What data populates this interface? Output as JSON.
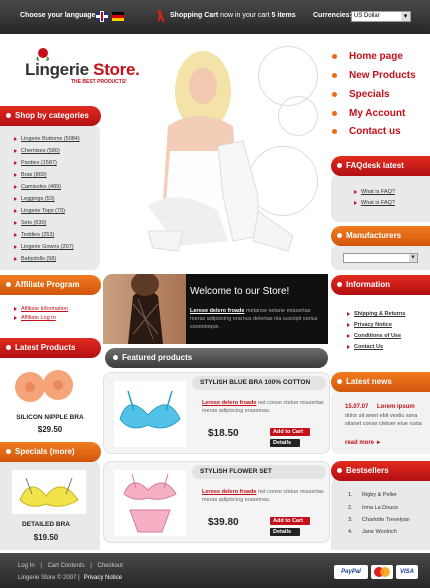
{
  "topbar": {
    "language_label": "Choose your language:",
    "cart_label": "Shopping Cart",
    "cart_status": "now in your cart",
    "cart_count": "5 items",
    "currency_label": "Currencies:",
    "currency_value": "US Dollar"
  },
  "logo": {
    "title_part1": "Lingerie ",
    "title_part2": "Store.",
    "slogan": "THE BEST PRODUCTS!"
  },
  "nav": {
    "items": [
      "Home page",
      "New Products",
      "Specials",
      "My Account",
      "Contact us"
    ]
  },
  "categories": {
    "heading": "Shop by categories",
    "items": [
      "Lingerie Bottoms (5084)",
      "Chemises (580)",
      "Panties (1587)",
      "Bras (869)",
      "Camisoles (489)",
      "Leggings (53)",
      "Lingerie Tops (79)",
      "Sets (630)",
      "Teddies (253)",
      "Lingerie Gowns (207)",
      "Babydolls (58)"
    ]
  },
  "affiliate": {
    "heading": "Affiliate Program",
    "links": [
      "Affiliate Information",
      "Affiliate Log In"
    ]
  },
  "latest": {
    "heading": "Latest Products",
    "product_name": "SILICON NIPPLE BRA",
    "product_price": "$29.50"
  },
  "specials": {
    "heading": "Specials",
    "more": "(more)",
    "product_name": "DETAILED BRA",
    "product_price": "$19.50"
  },
  "welcome": {
    "title": "Welcome to our Store!",
    "lead": "Lerose delero froade",
    "text": "metanse setane miasertas meras adipiscing erarnus delertas nia suscipit varius sooestoque."
  },
  "featured": {
    "heading": "Featured products",
    "products": [
      {
        "name": "STYLISH BLUE BRA 100% COTTON",
        "lead": "Lerose delero froade",
        "desc": "net conse ctetue miasertas meras adipiscing erasemas.",
        "price": "$18.50",
        "add_label": "Add to Cart",
        "details_label": "Details"
      },
      {
        "name": "STYLISH FLOWER SET",
        "lead": "Lerose delero froade",
        "desc": "net conse ctetue miasertas meras adipiscing erasemas.",
        "price": "$39.80",
        "add_label": "Add to Cart",
        "details_label": "Details"
      }
    ]
  },
  "faq": {
    "heading": "FAQdesk latest",
    "items": [
      "What is FAQ?",
      "What is FAQ?"
    ]
  },
  "manufacturers": {
    "heading": "Manufacturers"
  },
  "information": {
    "heading": "Information",
    "items": [
      "Shipping & Returns",
      "Privacy Notice",
      "Conditions of Use",
      "Contact Us"
    ]
  },
  "news": {
    "heading": "Latest news",
    "date": "15.07.07",
    "title": "Lorem ipsum",
    "body": "dolor sit amet ebit vestiu ssna sitanet conse ctetuer etue rusta",
    "read_more": "read more"
  },
  "bestsellers": {
    "heading": "Bestsellers",
    "items": [
      {
        "num": "1.",
        "name": "Rigby & Peller"
      },
      {
        "num": "2.",
        "name": "Irma La Douce"
      },
      {
        "num": "3.",
        "name": "Charlotte Trevelyan"
      },
      {
        "num": "4.",
        "name": "Jane Woolrich"
      }
    ]
  },
  "footer": {
    "links": [
      "Log In",
      "|",
      "Cart Contents",
      "|",
      "Checkout"
    ],
    "copyright": "Lingerie Store © 2007 |",
    "privacy": "Privacy Notice",
    "payment": [
      "PayPal",
      "MasterCard",
      "VISA"
    ]
  },
  "colors": {
    "accent_red": "#c3101a",
    "accent_orange": "#e86b17",
    "bar_dark": "#2e2e2e"
  }
}
